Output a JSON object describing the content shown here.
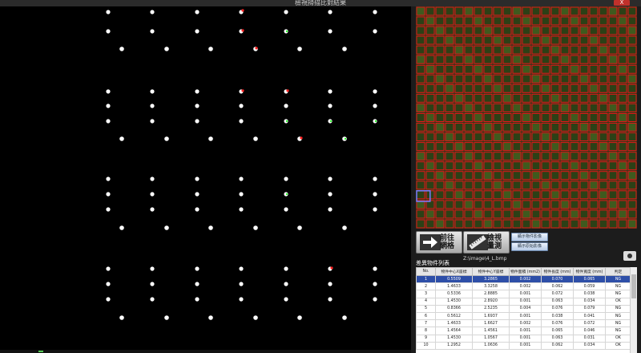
{
  "window": {
    "title": "檢視掃描比對結果",
    "close_label": "X"
  },
  "buttons": {
    "goto_grid": "前往\n網格",
    "measure": "檢視\n量測",
    "show_object_image": "顯示物件影像",
    "show_original_image": "顯示原始影像"
  },
  "image_path": "Z:\\image\\4_L.bmp",
  "table": {
    "title": "差異物件列表",
    "headers": [
      "No.",
      "物件中心X座標",
      "物件中心Y座標",
      "物件面積 (mm2)",
      "物件長度 (mm)",
      "物件寬度 (mm)",
      "判定"
    ],
    "rows": [
      [
        "1",
        "0.5509",
        "3.2865",
        "0.002",
        "0.070",
        "0.065",
        "NG"
      ],
      [
        "2",
        "1.4633",
        "3.3258",
        "0.002",
        "0.062",
        "0.059",
        "NG"
      ],
      [
        "3",
        "0.5336",
        "2.8885",
        "0.001",
        "0.072",
        "0.038",
        "NG"
      ],
      [
        "4",
        "1.4530",
        "2.8920",
        "0.001",
        "0.063",
        "0.034",
        "OK"
      ],
      [
        "5",
        "0.8366",
        "2.5235",
        "0.004",
        "0.076",
        "0.079",
        "NG"
      ],
      [
        "6",
        "0.5612",
        "1.6937",
        "0.001",
        "0.038",
        "0.041",
        "NG"
      ],
      [
        "7",
        "1.4633",
        "1.6627",
        "0.002",
        "0.076",
        "0.072",
        "NG"
      ],
      [
        "8",
        "1.4564",
        "1.4561",
        "0.001",
        "0.065",
        "0.046",
        "NG"
      ],
      [
        "9",
        "1.4530",
        "1.0567",
        "0.001",
        "0.063",
        "0.031",
        "OK"
      ],
      [
        "10",
        "1.2952",
        "1.0636",
        "0.001",
        "0.062",
        "0.034",
        "OK"
      ]
    ],
    "selected_row": 0
  },
  "colors": {
    "selected_row": "#2e4fa8",
    "defect_red": "#ff2020",
    "defect_green": "#2aff2a"
  }
}
